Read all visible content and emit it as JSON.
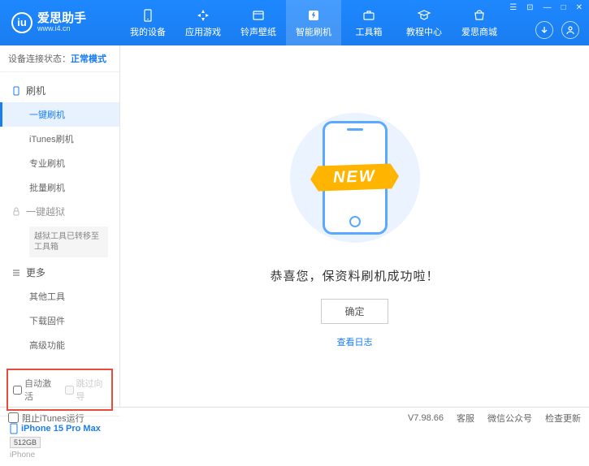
{
  "header": {
    "logo_title": "爱思助手",
    "logo_sub": "www.i4.cn",
    "nav": [
      {
        "label": "我的设备"
      },
      {
        "label": "应用游戏"
      },
      {
        "label": "铃声壁纸"
      },
      {
        "label": "智能刷机"
      },
      {
        "label": "工具箱"
      },
      {
        "label": "教程中心"
      },
      {
        "label": "爱思商城"
      }
    ]
  },
  "sidebar": {
    "status_label": "设备连接状态：",
    "status_mode": "正常模式",
    "section_flash": "刷机",
    "items_flash": [
      "一键刷机",
      "iTunes刷机",
      "专业刷机",
      "批量刷机"
    ],
    "section_jail": "一键越狱",
    "jail_note": "越狱工具已转移至工具箱",
    "section_more": "更多",
    "items_more": [
      "其他工具",
      "下载固件",
      "高级功能"
    ],
    "checkbox_auto": "自动激活",
    "checkbox_skip": "跳过向导",
    "device_name": "iPhone 15 Pro Max",
    "device_storage": "512GB",
    "device_type": "iPhone"
  },
  "main": {
    "new_badge": "NEW",
    "success_msg": "恭喜您，保资料刷机成功啦！",
    "ok_btn": "确定",
    "log_link": "查看日志"
  },
  "footer": {
    "block_itunes": "阻止iTunes运行",
    "version": "V7.98.66",
    "links": [
      "客服",
      "微信公众号",
      "检查更新"
    ]
  }
}
